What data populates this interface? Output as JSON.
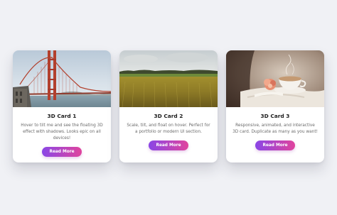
{
  "cards": [
    {
      "title": "3D Card 1",
      "description": "Hover to tilt me and see the floating 3D effect with shadows. Looks epic on all devices!",
      "button_label": "Read More",
      "image": "golden-gate-bridge-photo"
    },
    {
      "title": "3D Card 2",
      "description": "Scale, tilt, and float on hover. Perfect for a portfolio or modern UI section.",
      "button_label": "Read More",
      "image": "wheat-field-photo"
    },
    {
      "title": "3D Card 3",
      "description": "Responsive, animated, and interactive 3D card. Duplicate as many as you want!",
      "button_label": "Read More",
      "image": "tea-cup-flower-photo"
    }
  ],
  "colors": {
    "page_background": "#f0f1f5",
    "card_background": "#ffffff",
    "button_gradient_start": "#8a46e6",
    "button_gradient_end": "#e0449d",
    "title_text": "#1c1c1c",
    "body_text": "#6a6a6a"
  }
}
